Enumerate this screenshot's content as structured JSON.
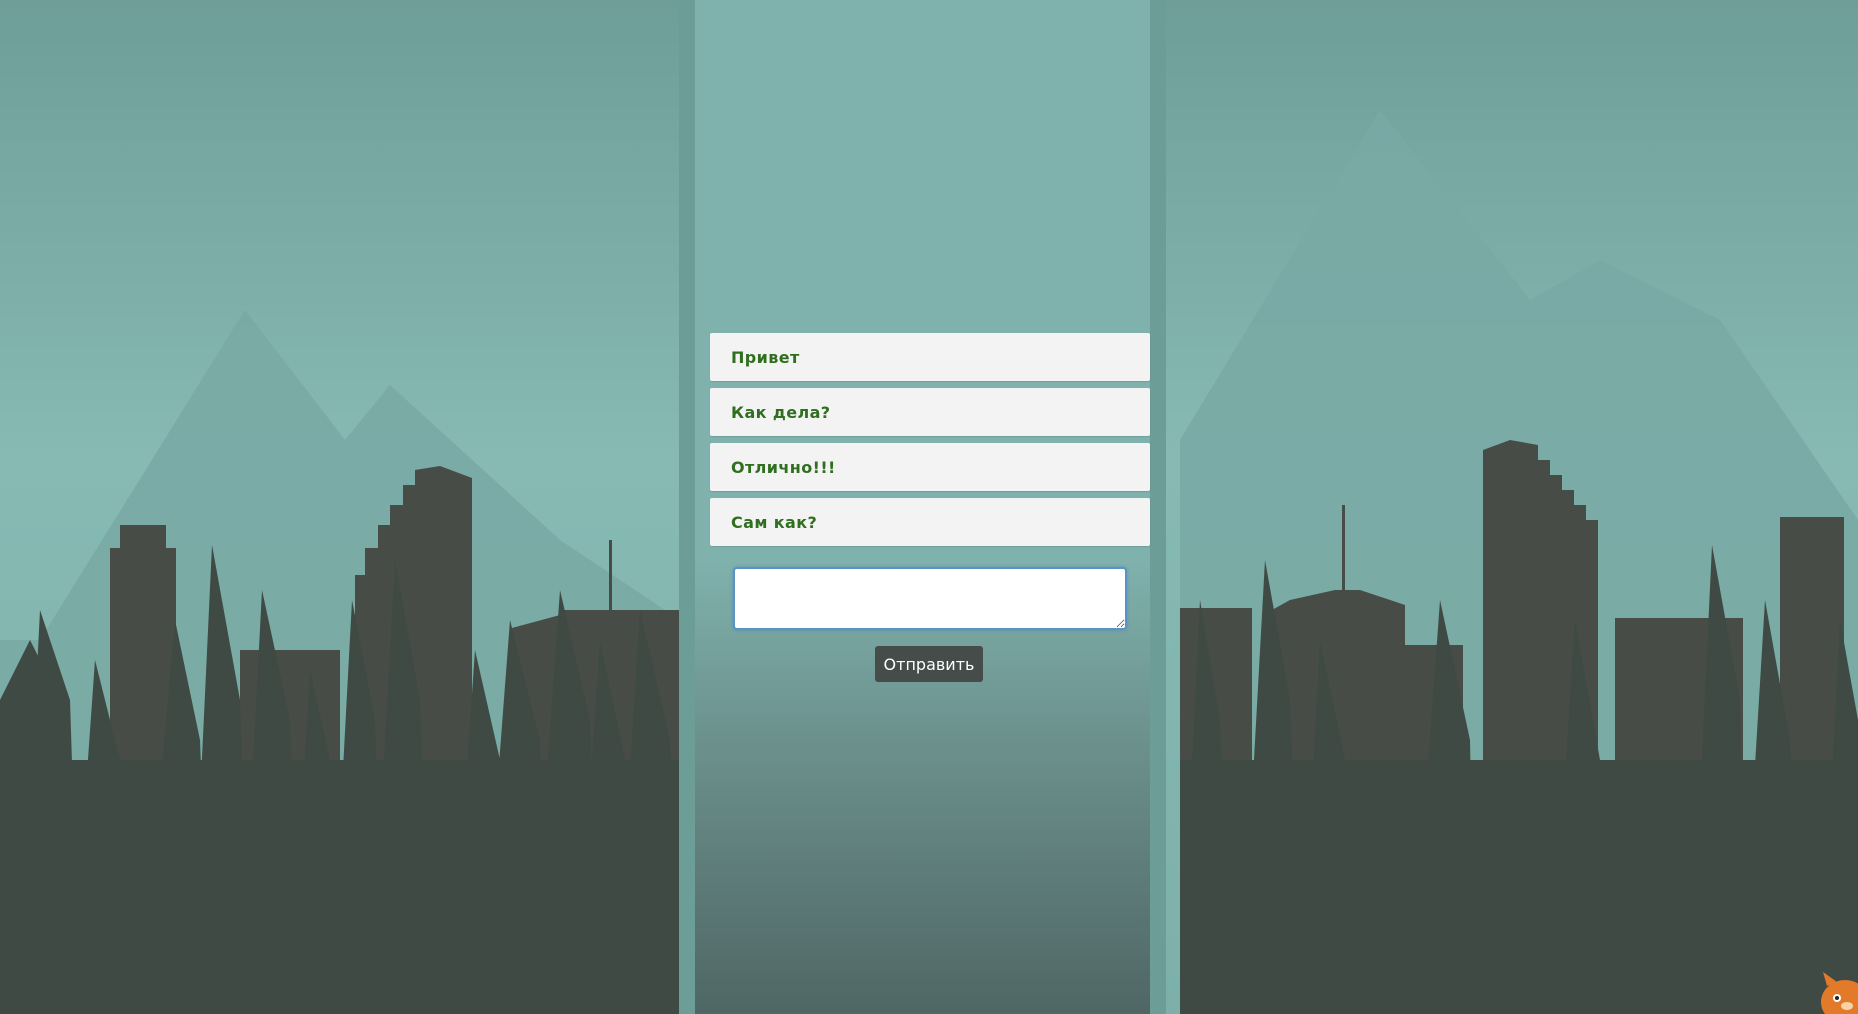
{
  "chat": {
    "messages": [
      {
        "text": "Привет"
      },
      {
        "text": "Как дела?"
      },
      {
        "text": "Отлично!!!"
      },
      {
        "text": "Сам как?"
      }
    ],
    "input_value": "",
    "send_label": "Отправить"
  },
  "colors": {
    "sky": "#7fb0aa",
    "silhouette": "#474c47",
    "message_text": "#2f6f1f",
    "message_bg": "#f3f3f3",
    "button_bg": "#454c4a",
    "input_focus_border": "#5b93c6"
  },
  "icons": {
    "mascot": "fox-mascot-icon"
  }
}
